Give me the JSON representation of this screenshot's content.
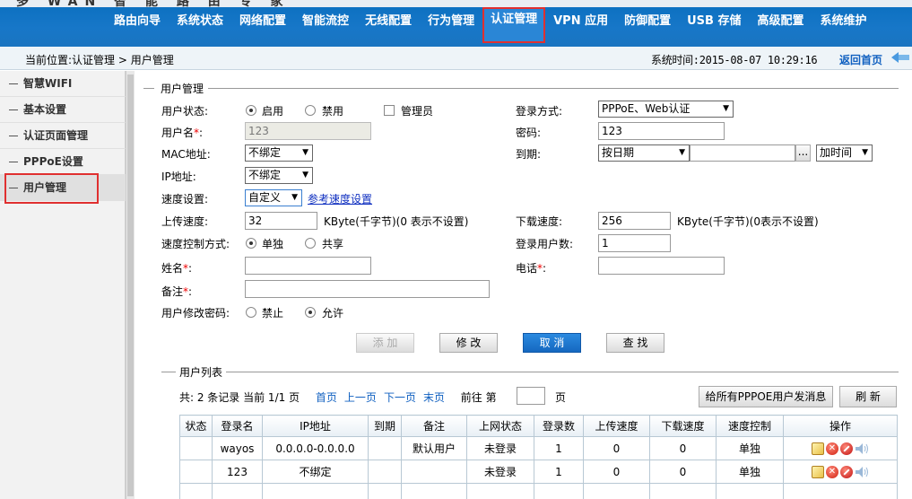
{
  "banner": {
    "brand_fragment": "多 WAN 智 能 路 由 专 家",
    "nav": [
      {
        "label": "路由向导"
      },
      {
        "label": "系统状态"
      },
      {
        "label": "网络配置"
      },
      {
        "label": "智能流控"
      },
      {
        "label": "无线配置"
      },
      {
        "label": "行为管理"
      },
      {
        "label": "认证管理",
        "active": true
      },
      {
        "label": "VPN 应用"
      },
      {
        "label": "防御配置"
      },
      {
        "label": "USB 存储"
      },
      {
        "label": "高级配置"
      },
      {
        "label": "系统维护"
      }
    ]
  },
  "location": {
    "text": "当前位置:认证管理 > 用户管理",
    "system_time": "系统时间:2015-08-07 10:29:16",
    "home_label": "返回首页"
  },
  "sidebar": {
    "items": [
      {
        "label": "智慧WIFI"
      },
      {
        "label": "基本设置"
      },
      {
        "label": "认证页面管理"
      },
      {
        "label": "PPPoE设置"
      },
      {
        "label": "用户管理",
        "active": true
      }
    ]
  },
  "form": {
    "legend": "用户管理",
    "user_status_label": "用户状态:",
    "enable_label": "启用",
    "disable_label": "禁用",
    "admin_label": "管理员",
    "login_mode_label": "登录方式:",
    "login_mode_value": "PPPoE、Web认证",
    "username_label": "用户名",
    "username_value": "123",
    "password_label": "密码:",
    "password_value": "123",
    "mac_label": "MAC地址:",
    "mac_value": "不绑定",
    "expire_label": "到期:",
    "expire_mode": "按日期",
    "expire_date_value": "",
    "expire_browse": "...",
    "add_time_value": "加时间",
    "ip_label": "IP地址:",
    "ip_value": "不绑定",
    "speed_setting_label": "速度设置:",
    "speed_setting_value": "自定义",
    "ref_speed_link": "参考速度设置",
    "upload_label": "上传速度:",
    "upload_value": "32",
    "upload_unit": "KByte(千字节)(0 表示不设置)",
    "download_label": "下载速度:",
    "download_value": "256",
    "download_unit": "KByte(千字节)(0表示不设置)",
    "speed_ctrl_label": "速度控制方式:",
    "single_label": "单独",
    "shared_label": "共享",
    "login_count_label": "登录用户数:",
    "login_count_value": "1",
    "name_label": "姓名",
    "name_value": "",
    "phone_label": "电话",
    "phone_value": "",
    "note_label": "备注",
    "note_value": "",
    "user_pw_label": "用户修改密码:",
    "forbid_label": "禁止",
    "allow_label": "允许",
    "required_mark": "*",
    "colon": ":",
    "buttons": {
      "add": "添 加",
      "modify": "修 改",
      "cancel": "取 消",
      "search": "查 找"
    }
  },
  "list": {
    "legend": "用户列表",
    "pager": {
      "summary": "共: 2 条记录 当前 1/1 页",
      "first": "首页",
      "prev": "上一页",
      "next": "下一页",
      "last": "末页",
      "goto_prefix": "前往 第",
      "goto_value": "",
      "goto_suffix": "页"
    },
    "send_msg_button": "给所有PPPOE用户发消息",
    "refresh_button": "刷 新",
    "columns": [
      "状态",
      "登录名",
      "IP地址",
      "到期",
      "备注",
      "上网状态",
      "登录数",
      "上传速度",
      "下载速度",
      "速度控制",
      "操作"
    ],
    "rows": [
      {
        "status": "",
        "login": "wayos",
        "ip": "0.0.0.0-0.0.0.0",
        "expire": "",
        "note": "默认用户",
        "online": "未登录",
        "count": "1",
        "up": "0",
        "down": "0",
        "ctrl": "单独"
      },
      {
        "status": "",
        "login": "123",
        "ip": "不绑定",
        "expire": "",
        "note": "",
        "online": "未登录",
        "count": "1",
        "up": "0",
        "down": "0",
        "ctrl": "单独"
      }
    ]
  },
  "colors": {
    "banner_blue": "#1777c8",
    "highlight_red": "#e03030",
    "link_blue": "#1060c0"
  }
}
